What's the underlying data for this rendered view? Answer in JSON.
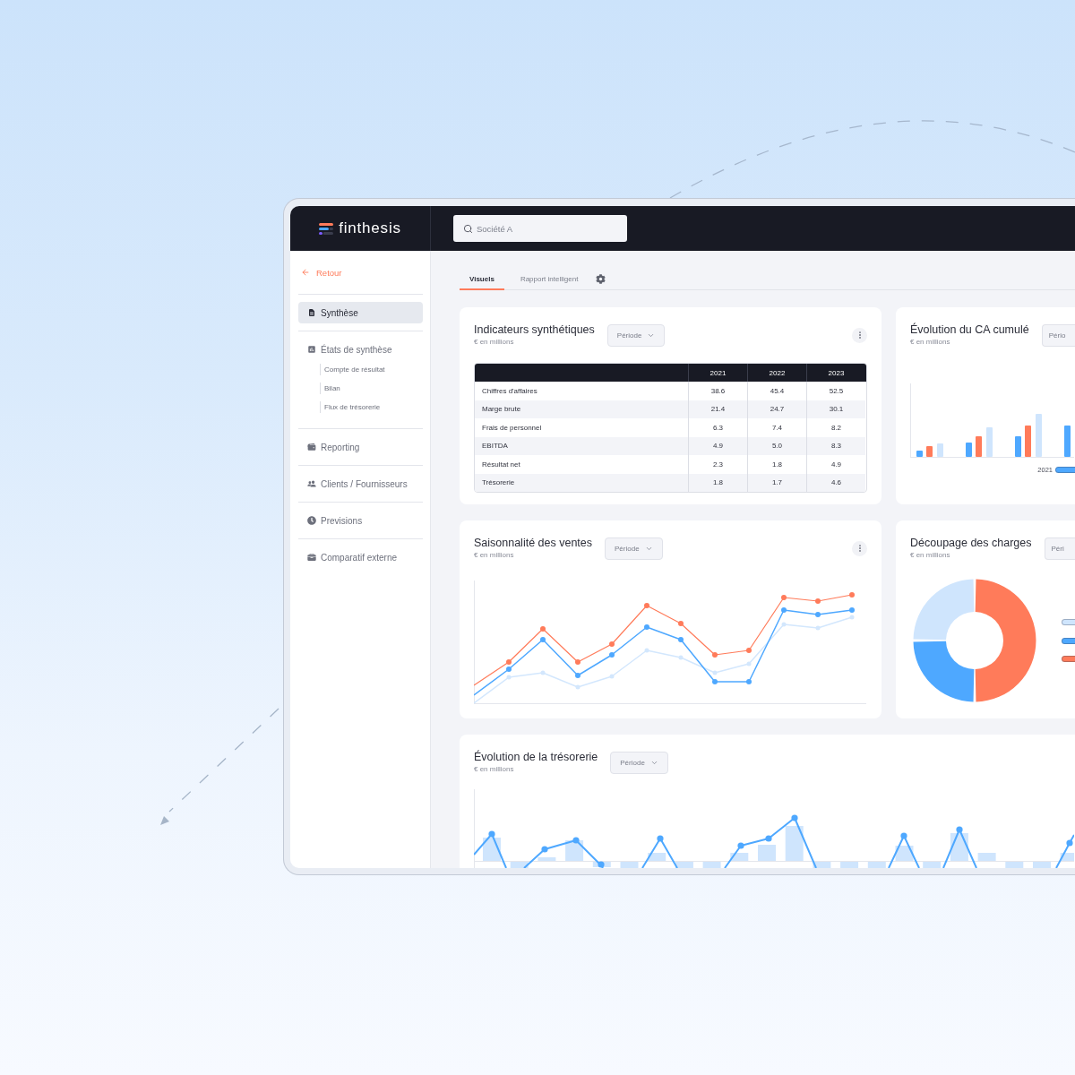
{
  "app": {
    "logo": "finthesis"
  },
  "search": {
    "placeholder": "Société A"
  },
  "sidebar": {
    "back_link": "Retour",
    "items": [
      {
        "label": "Synthèse",
        "selected": true
      },
      {
        "label": "États de synthèse",
        "selected": false,
        "children": [
          {
            "label": "Compte de résultat",
            "selected": false
          },
          {
            "label": "Bilan",
            "selected": false
          },
          {
            "label": "Flux de trésorerie",
            "selected": false
          }
        ]
      },
      {
        "label": "Reporting",
        "selected": false
      },
      {
        "label": "Clients / Fournisseurs",
        "selected": false
      },
      {
        "label": "Previsions",
        "selected": false
      },
      {
        "label": "Comparatif externe",
        "selected": false
      }
    ]
  },
  "tabs": [
    {
      "label": "Visuels",
      "selected": true
    },
    {
      "label": "Rapport intelligent",
      "selected": false
    }
  ],
  "cards": [
    {
      "kind": "table",
      "title": "Indicateurs synthétiques",
      "subtitle": "€ en millions",
      "period_button": "Période",
      "menu_button": true,
      "table": {
        "columns": [
          "2021",
          "2022",
          "2023"
        ],
        "rows": [
          {
            "label": "Chiffres d'affaires",
            "values": [
              "38.6",
              "45.4",
              "52.5"
            ]
          },
          {
            "label": "Marge brute",
            "values": [
              "21.4",
              "24.7",
              "30.1"
            ]
          },
          {
            "label": "Frais de personnel",
            "values": [
              "6.3",
              "7.4",
              "8.2"
            ]
          },
          {
            "label": "EBITDA",
            "values": [
              "4.9",
              "5.0",
              "8.3"
            ]
          },
          {
            "label": "Résultat net",
            "values": [
              "2.3",
              "1.8",
              "4.9"
            ]
          },
          {
            "label": "Trésorerie",
            "values": [
              "1.8",
              "1.7",
              "4.6"
            ]
          }
        ]
      }
    },
    {
      "kind": "bar",
      "title": "Évolution du CA cumulé",
      "subtitle": "€ en millions",
      "period_button": "Pério",
      "menu_button": false,
      "legend": [
        {
          "label": "2021"
        }
      ]
    },
    {
      "kind": "line",
      "title": "Saisonnalité des ventes",
      "subtitle": "€ en millions",
      "period_button": "Période",
      "menu_button": true
    },
    {
      "kind": "donut",
      "title": "Découpage des charges",
      "subtitle": "€ en millions",
      "period_button": "Péri",
      "menu_button": false,
      "legend": [
        {
          "color": "#cfe5fd"
        },
        {
          "color": "#4ea8ff"
        },
        {
          "color": "#ff7b5a"
        }
      ]
    },
    {
      "kind": "combo",
      "title": "Évolution de la trésorerie",
      "subtitle": "€ en millions",
      "period_button": "Période",
      "menu_button": false
    }
  ]
}
